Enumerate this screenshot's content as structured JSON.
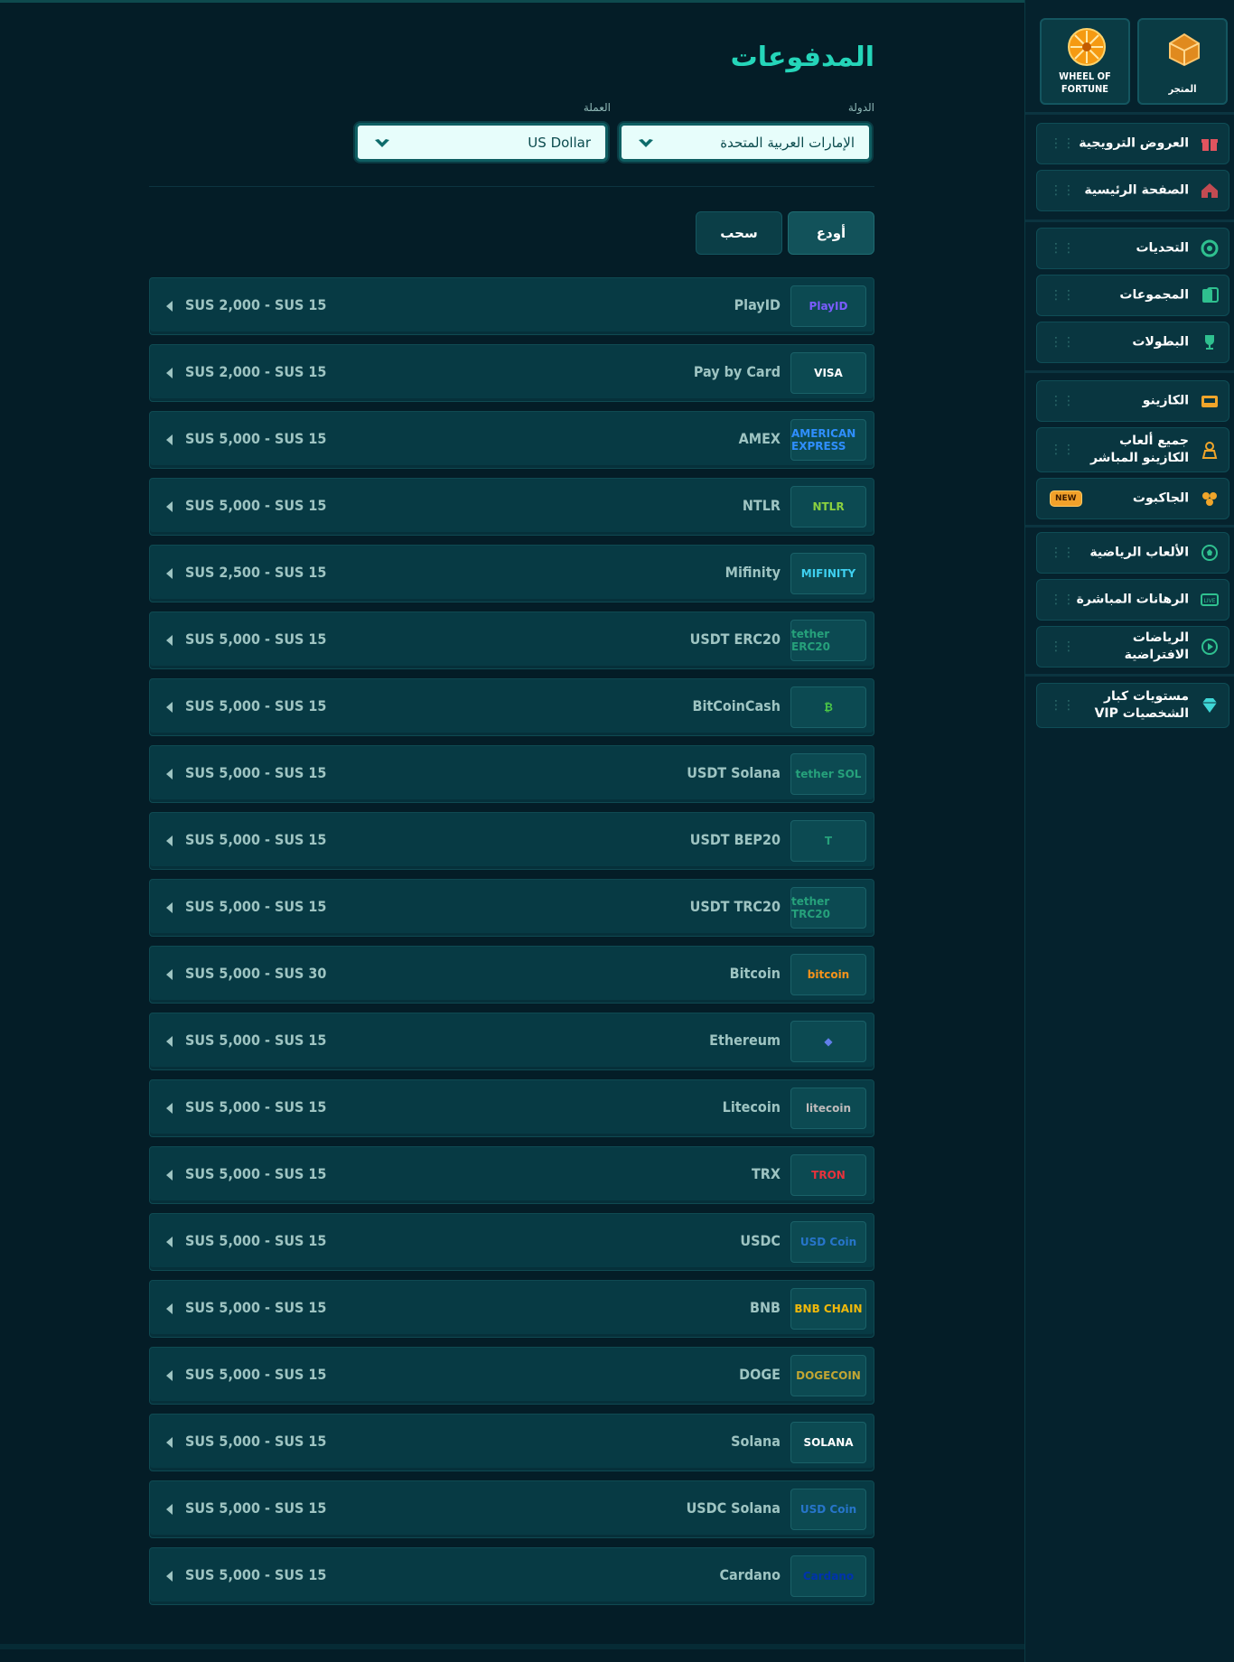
{
  "page_title": "المدفوعات",
  "country_label": "الدولة",
  "country_value": "الإمارات العربية المتحدة",
  "currency_label": "العملة",
  "currency_value": "US Dollar",
  "tabs": {
    "deposit": "أودع",
    "withdraw": "سحب"
  },
  "methods": [
    {
      "name": "PlayID",
      "range": "SUS 2,000 - SUS 15",
      "logo_text": "PlayID",
      "logo_color": "#7b5cff"
    },
    {
      "name": "Pay by Card",
      "range": "SUS 2,000 - SUS 15",
      "logo_text": "VISA",
      "logo_color": "#ffffff"
    },
    {
      "name": "AMEX",
      "range": "SUS 5,000 - SUS 15",
      "logo_text": "AMERICAN EXPRESS",
      "logo_color": "#2f8fff"
    },
    {
      "name": "NTLR",
      "range": "SUS 5,000 - SUS 15",
      "logo_text": "NTLR",
      "logo_color": "#8bd13f"
    },
    {
      "name": "Mifinity",
      "range": "SUS 2,500 - SUS 15",
      "logo_text": "MIFINITY",
      "logo_color": "#3fd0f0"
    },
    {
      "name": "USDT ERC20",
      "range": "SUS 5,000 - SUS 15",
      "logo_text": "tether ERC20",
      "logo_color": "#26a17b"
    },
    {
      "name": "BitCoinCash",
      "range": "SUS 5,000 - SUS 15",
      "logo_text": "₿",
      "logo_color": "#4cc947"
    },
    {
      "name": "USDT Solana",
      "range": "SUS 5,000 - SUS 15",
      "logo_text": "tether SOL",
      "logo_color": "#26a17b"
    },
    {
      "name": "USDT BEP20",
      "range": "SUS 5,000 - SUS 15",
      "logo_text": "T",
      "logo_color": "#26a17b"
    },
    {
      "name": "USDT TRC20",
      "range": "SUS 5,000 - SUS 15",
      "logo_text": "tether TRC20",
      "logo_color": "#26a17b"
    },
    {
      "name": "Bitcoin",
      "range": "SUS 5,000 - SUS 30",
      "logo_text": "bitcoin",
      "logo_color": "#f7931a"
    },
    {
      "name": "Ethereum",
      "range": "SUS 5,000 - SUS 15",
      "logo_text": "◆",
      "logo_color": "#627eea"
    },
    {
      "name": "Litecoin",
      "range": "SUS 5,000 - SUS 15",
      "logo_text": "litecoin",
      "logo_color": "#bfbbbb"
    },
    {
      "name": "TRX",
      "range": "SUS 5,000 - SUS 15",
      "logo_text": "TRON",
      "logo_color": "#e8323c"
    },
    {
      "name": "USDC",
      "range": "SUS 5,000 - SUS 15",
      "logo_text": "USD Coin",
      "logo_color": "#2775ca"
    },
    {
      "name": "BNB",
      "range": "SUS 5,000 - SUS 15",
      "logo_text": "BNB CHAIN",
      "logo_color": "#f0b90b"
    },
    {
      "name": "DOGE",
      "range": "SUS 5,000 - SUS 15",
      "logo_text": "DOGECOIN",
      "logo_color": "#c2a633"
    },
    {
      "name": "Solana",
      "range": "SUS 5,000 - SUS 15",
      "logo_text": "SOLANA",
      "logo_color": "#ffffff"
    },
    {
      "name": "USDC Solana",
      "range": "SUS 5,000 - SUS 15",
      "logo_text": "USD Coin",
      "logo_color": "#2775ca"
    },
    {
      "name": "Cardano",
      "range": "SUS 5,000 - SUS 15",
      "logo_text": "Cardano",
      "logo_color": "#0033ad"
    }
  ],
  "sidebar": {
    "tiles": {
      "shop": "المتجر",
      "wheel_line1": "WHEEL OF",
      "wheel_line2": "FORTUNE"
    },
    "group1": [
      {
        "label": "العروض الترويجية",
        "icon": "gift-icon",
        "color": "#e0545f"
      },
      {
        "label": "الصفحة الرئيسية",
        "icon": "home-icon",
        "color": "#c24b52"
      }
    ],
    "group2": [
      {
        "label": "التحديات",
        "icon": "badge-icon",
        "color": "#2fc08f"
      },
      {
        "label": "المجموعات",
        "icon": "cards-icon",
        "color": "#2fc08f"
      },
      {
        "label": "البطولات",
        "icon": "trophy-icon",
        "color": "#2fc08f"
      }
    ],
    "group3": [
      {
        "label": "الكازينو",
        "icon": "casino-icon",
        "color": "#f0a52a"
      },
      {
        "label": "جميع ألعاب الكازينو المباشر",
        "icon": "dealer-icon",
        "color": "#f0a52a"
      },
      {
        "label": "الجاكبوت",
        "icon": "jackpot-icon",
        "color": "#f0a52a",
        "badge": "NEW"
      }
    ],
    "group4": [
      {
        "label": "الألعاب الرياضية",
        "icon": "soccer-icon",
        "color": "#2fc08f"
      },
      {
        "label": "الرهانات المباشرة",
        "icon": "live-icon",
        "color": "#2fc08f"
      },
      {
        "label": "الرياضات الافتراضية",
        "icon": "play-icon",
        "color": "#2fc08f"
      }
    ],
    "group5": [
      {
        "label": "مستويات كبار الشخصيات VIP",
        "icon": "diamond-icon",
        "color": "#3fd6d6"
      }
    ]
  }
}
